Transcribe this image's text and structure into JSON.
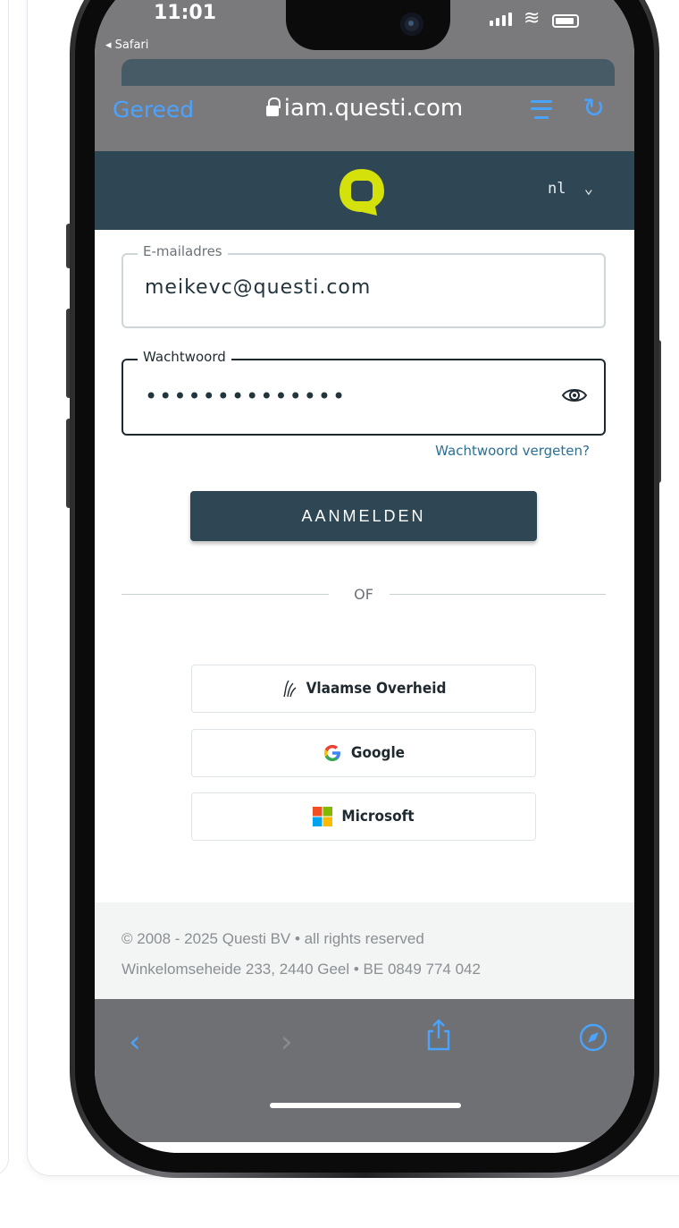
{
  "status_bar": {
    "time": "11:01",
    "back_app": "Safari"
  },
  "browser": {
    "done_label": "Gereed",
    "url": "iam.questi.com"
  },
  "app_header": {
    "language": "nl"
  },
  "form": {
    "email": {
      "label": "E-mailadres",
      "value": "meikevc@questi.com"
    },
    "password": {
      "label": "Wachtwoord",
      "value": "••••••••••••••"
    },
    "forgot_link": "Wachtwoord vergeten?",
    "login_button": "AANMELDEN",
    "divider_text": "OF"
  },
  "identity_providers": [
    {
      "label": "Vlaamse Overheid",
      "icon": "vlaamse-overheid-icon"
    },
    {
      "label": "Google",
      "icon": "google-icon"
    },
    {
      "label": "Microsoft",
      "icon": "microsoft-icon"
    }
  ],
  "footer": {
    "line1": "© 2008 - 2025 Questi BV • all rights reserved",
    "line2": "Winkelomseheide 233, 2440 Geel • BE 0849 774 042"
  },
  "colors": {
    "brand_dark": "#2f4754",
    "logo_yellow": "#d5e10a",
    "link_blue": "#2c6f93",
    "safari_blue": "#4aa3ff"
  }
}
